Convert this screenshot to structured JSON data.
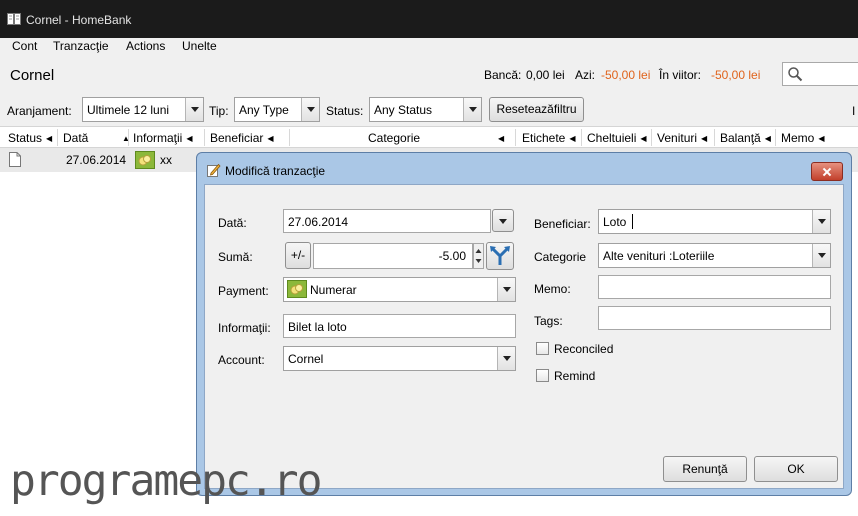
{
  "window": {
    "title": "Cornel - HomeBank"
  },
  "menu": [
    {
      "id": "cont",
      "label": "Cont"
    },
    {
      "id": "tranzactie",
      "label": "Tranzacţie"
    },
    {
      "id": "actions",
      "label": "Actions"
    },
    {
      "id": "unelte",
      "label": "Unelte"
    }
  ],
  "account": {
    "name": "Cornel",
    "bank_label": "Bancă:",
    "bank_value": "0,00 lei",
    "today_label": "Azi:",
    "today_value": "-50,00 lei",
    "future_label": "În viitor:",
    "future_value": "-50,00 lei",
    "negative_color": "#e0631b"
  },
  "filter": {
    "arrangement_label": "Aranjament:",
    "arrangement_value": "Ultimele 12 luni",
    "type_label": "Tip:",
    "type_value": "Any Type",
    "status_label": "Status:",
    "status_value": "Any Status",
    "reset_label": "Reseteazăfiltru",
    "right_edge_mark": "I"
  },
  "columns": [
    "Status",
    "Dată",
    "Informaţii",
    "Beneficiar",
    "Categorie",
    "Etichete",
    "Cheltuieli",
    "Venituri",
    "Balanţă",
    "Memo"
  ],
  "row": {
    "date": "27.06.2014",
    "info": "xx",
    "status_icon": "document-icon",
    "payment_icon": "cash-icon"
  },
  "dialog": {
    "title": "Modifică tranzacţie",
    "date_label": "Dată:",
    "date_value": "27.06.2014",
    "amount_label": "Sumă:",
    "sign_button": "+/-",
    "amount_value": "-5.00",
    "payment_label": "Payment:",
    "payment_value": "Numerar",
    "info_label": "Informaţii:",
    "info_value": "Bilet la loto",
    "account_label": "Account:",
    "account_value": "Cornel",
    "payee_label": "Beneficiar:",
    "payee_value": "Loto",
    "category_label": "Categorie",
    "category_value": "Alte venituri :Loteriile",
    "memo_label": "Memo:",
    "memo_value": "",
    "tags_label": "Tags:",
    "tags_value": "",
    "reconciled_label": "Reconciled",
    "remind_label": "Remind",
    "cancel_label": "Renunţă",
    "ok_label": "OK"
  },
  "watermark": "programepc.ro"
}
